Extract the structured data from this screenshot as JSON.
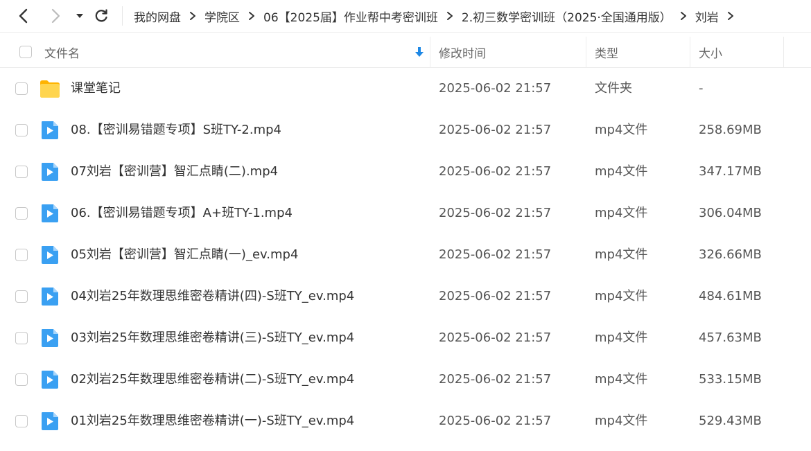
{
  "breadcrumb": [
    "我的网盘",
    "学院区",
    "06【2025届】作业帮中考密训班",
    "2.初三数学密训班（2025·全国通用版）",
    "刘岩"
  ],
  "columns": {
    "name": "文件名",
    "modified": "修改时间",
    "type": "类型",
    "size": "大小"
  },
  "files": [
    {
      "name": "课堂笔记",
      "modified": "2025-06-02 21:57",
      "type": "文件夹",
      "size": "-",
      "icon": "folder-icon"
    },
    {
      "name": "08.【密训易错题专项】S班TY-2.mp4",
      "modified": "2025-06-02 21:57",
      "type": "mp4文件",
      "size": "258.69MB",
      "icon": "video-file-icon"
    },
    {
      "name": "07刘岩【密训营】智汇点睛(二).mp4",
      "modified": "2025-06-02 21:57",
      "type": "mp4文件",
      "size": "347.17MB",
      "icon": "video-file-icon"
    },
    {
      "name": "06.【密训易错题专项】A+班TY-1.mp4",
      "modified": "2025-06-02 21:57",
      "type": "mp4文件",
      "size": "306.04MB",
      "icon": "video-file-icon"
    },
    {
      "name": "05刘岩【密训营】智汇点睛(一)_ev.mp4",
      "modified": "2025-06-02 21:57",
      "type": "mp4文件",
      "size": "326.66MB",
      "icon": "video-file-icon"
    },
    {
      "name": "04刘岩25年数理思维密卷精讲(四)-S班TY_ev.mp4",
      "modified": "2025-06-02 21:57",
      "type": "mp4文件",
      "size": "484.61MB",
      "icon": "video-file-icon"
    },
    {
      "name": "03刘岩25年数理思维密卷精讲(三)-S班TY_ev.mp4",
      "modified": "2025-06-02 21:57",
      "type": "mp4文件",
      "size": "457.63MB",
      "icon": "video-file-icon"
    },
    {
      "name": "02刘岩25年数理思维密卷精讲(二)-S班TY_ev.mp4",
      "modified": "2025-06-02 21:57",
      "type": "mp4文件",
      "size": "533.15MB",
      "icon": "video-file-icon"
    },
    {
      "name": "01刘岩25年数理思维密卷精讲(一)-S班TY_ev.mp4",
      "modified": "2025-06-02 21:57",
      "type": "mp4文件",
      "size": "529.43MB",
      "icon": "video-file-icon"
    }
  ],
  "colors": {
    "accent": "#1e88e5",
    "folder": "#ffc107",
    "video": "#3aa0f2",
    "text": "#333333",
    "border": "#ececec"
  }
}
